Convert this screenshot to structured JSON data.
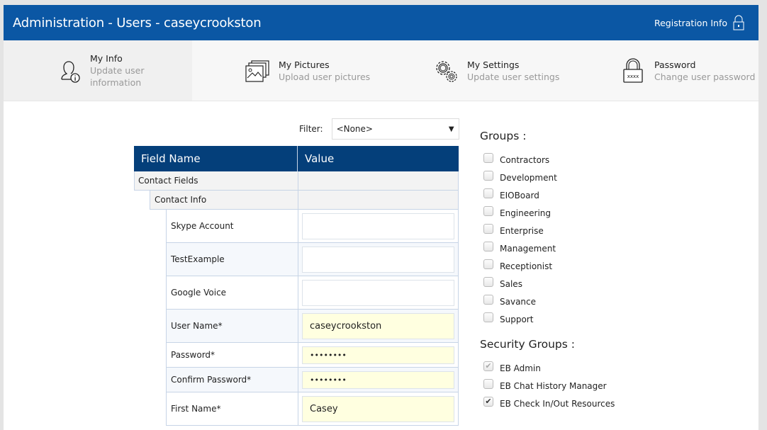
{
  "header": {
    "title": "Administration - Users - caseycrookston",
    "registration_label": "Registration Info"
  },
  "tabs": [
    {
      "label": "My Info",
      "sub": "Update user information",
      "icon": "user-info-icon"
    },
    {
      "label": "My Pictures",
      "sub": "Upload user pictures",
      "icon": "pictures-icon"
    },
    {
      "label": "My Settings",
      "sub": "Update user settings",
      "icon": "gears-icon"
    },
    {
      "label": "Password",
      "sub": "Change user password",
      "icon": "padlock-icon"
    }
  ],
  "filter": {
    "label": "Filter:",
    "value": "<None>"
  },
  "grid": {
    "headers": [
      "Field Name",
      "Value"
    ],
    "group": "Contact Fields",
    "subgroup": "Contact Info",
    "rows": [
      {
        "label": "Skype Account",
        "value": ""
      },
      {
        "label": "TestExample",
        "value": ""
      },
      {
        "label": "Google Voice",
        "value": ""
      },
      {
        "label": "User Name*",
        "value": "caseycrookston"
      },
      {
        "label": "Password*",
        "value": "••••••••"
      },
      {
        "label": "Confirm Password*",
        "value": "••••••••"
      },
      {
        "label": "First Name*",
        "value": "Casey"
      }
    ]
  },
  "groups": {
    "title": "Groups :",
    "items": [
      {
        "label": "Contractors",
        "checked": false
      },
      {
        "label": "Development",
        "checked": false
      },
      {
        "label": "EIOBoard",
        "checked": false
      },
      {
        "label": "Engineering",
        "checked": false
      },
      {
        "label": "Enterprise",
        "checked": false
      },
      {
        "label": "Management",
        "checked": false
      },
      {
        "label": "Receptionist",
        "checked": false
      },
      {
        "label": "Sales",
        "checked": false
      },
      {
        "label": "Savance",
        "checked": false
      },
      {
        "label": "Support",
        "checked": false
      }
    ]
  },
  "security_groups": {
    "title": "Security Groups :",
    "items": [
      {
        "label": "EB Admin",
        "checked": true,
        "disabled": true
      },
      {
        "label": "EB Chat History Manager",
        "checked": false,
        "disabled": false
      },
      {
        "label": "EB Check In/Out Resources",
        "checked": true,
        "disabled": false
      }
    ]
  }
}
